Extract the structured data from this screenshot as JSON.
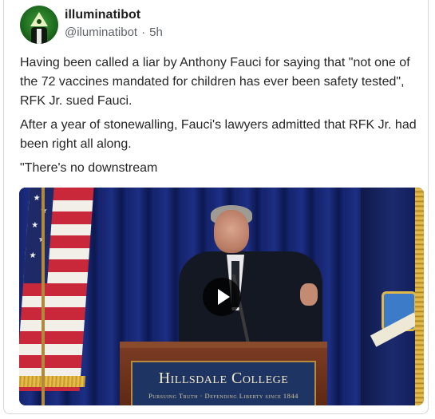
{
  "post": {
    "author_name": "illuminatibot",
    "author_handle": "@iluminatibot",
    "separator": "·",
    "time_ago": "5h",
    "paragraphs": [
      "Having been called a liar by Anthony Fauci for saying that \"not one of the 72 vaccines mandated for children has ever been safety tested\", RFK Jr. sued Fauci.",
      "After a year of stonewalling, Fauci's lawyers admitted that RFK Jr. had been right all along.",
      "\"There's no downstream"
    ]
  },
  "video": {
    "podium_sign_title": "Hillsdale College",
    "podium_sign_subtitle": "Pursuing Truth · Defending Liberty since 1844",
    "play_icon": "play-icon"
  },
  "colors": {
    "handle_gray": "#5f6368",
    "text": "#262626",
    "avatar_green": "#1f6e1f"
  }
}
